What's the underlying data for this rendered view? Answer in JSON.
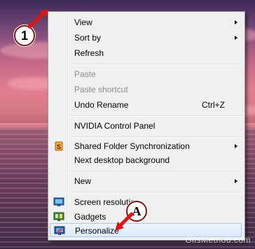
{
  "context_menu": {
    "items": [
      {
        "label": "View",
        "submenu": true
      },
      {
        "label": "Sort by",
        "submenu": true
      },
      {
        "label": "Refresh"
      },
      {
        "label": "Paste",
        "disabled": true
      },
      {
        "label": "Paste shortcut",
        "disabled": true
      },
      {
        "label": "Undo Rename",
        "shortcut": "Ctrl+Z"
      },
      {
        "label": "NVIDIA Control Panel"
      },
      {
        "label": "Shared Folder Synchronization",
        "submenu": true,
        "icon": "shared-folder-sync-icon"
      },
      {
        "label": "Next desktop background"
      },
      {
        "label": "New",
        "submenu": true
      },
      {
        "label": "Screen resolution",
        "icon": "screen-resolution-icon"
      },
      {
        "label": "Gadgets",
        "icon": "gadgets-icon"
      },
      {
        "label": "Personalize",
        "icon": "personalize-icon"
      }
    ]
  },
  "annotations": {
    "callout_1": "1",
    "callout_a": "A",
    "arrow_color": "#d81818"
  },
  "watermark": "GilsMethod.com"
}
